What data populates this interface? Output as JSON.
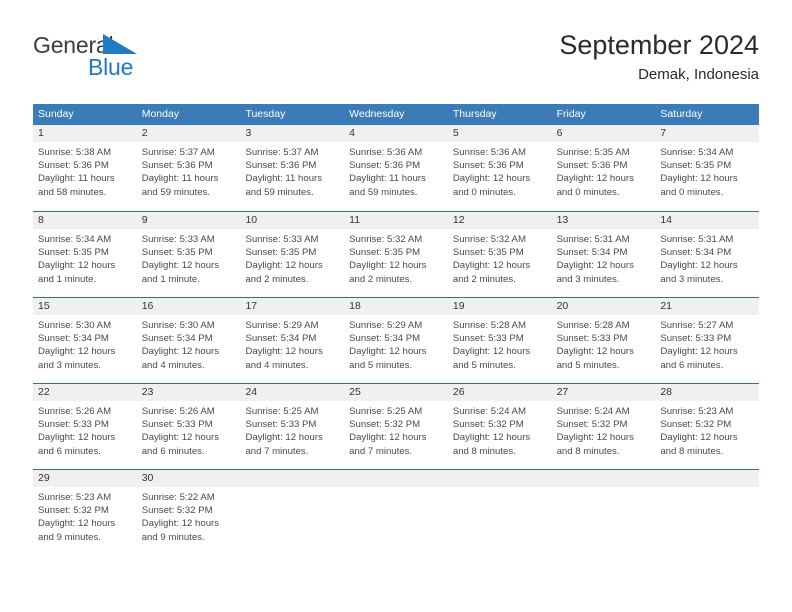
{
  "brand": {
    "name_part1": "General",
    "name_part2": "Blue",
    "accent_color": "#1f7bc4",
    "logo_icon": "triangle-flag-icon"
  },
  "header": {
    "title": "September 2024",
    "subtitle": "Demak, Indonesia"
  },
  "calendar": {
    "header_bg": "#3b7cb8",
    "weekday_headers": [
      "Sunday",
      "Monday",
      "Tuesday",
      "Wednesday",
      "Thursday",
      "Friday",
      "Saturday"
    ],
    "weeks": [
      [
        {
          "day": "1",
          "sunrise": "Sunrise: 5:38 AM",
          "sunset": "Sunset: 5:36 PM",
          "daylight": "Daylight: 11 hours and 58 minutes."
        },
        {
          "day": "2",
          "sunrise": "Sunrise: 5:37 AM",
          "sunset": "Sunset: 5:36 PM",
          "daylight": "Daylight: 11 hours and 59 minutes."
        },
        {
          "day": "3",
          "sunrise": "Sunrise: 5:37 AM",
          "sunset": "Sunset: 5:36 PM",
          "daylight": "Daylight: 11 hours and 59 minutes."
        },
        {
          "day": "4",
          "sunrise": "Sunrise: 5:36 AM",
          "sunset": "Sunset: 5:36 PM",
          "daylight": "Daylight: 11 hours and 59 minutes."
        },
        {
          "day": "5",
          "sunrise": "Sunrise: 5:36 AM",
          "sunset": "Sunset: 5:36 PM",
          "daylight": "Daylight: 12 hours and 0 minutes."
        },
        {
          "day": "6",
          "sunrise": "Sunrise: 5:35 AM",
          "sunset": "Sunset: 5:36 PM",
          "daylight": "Daylight: 12 hours and 0 minutes."
        },
        {
          "day": "7",
          "sunrise": "Sunrise: 5:34 AM",
          "sunset": "Sunset: 5:35 PM",
          "daylight": "Daylight: 12 hours and 0 minutes."
        }
      ],
      [
        {
          "day": "8",
          "sunrise": "Sunrise: 5:34 AM",
          "sunset": "Sunset: 5:35 PM",
          "daylight": "Daylight: 12 hours and 1 minute."
        },
        {
          "day": "9",
          "sunrise": "Sunrise: 5:33 AM",
          "sunset": "Sunset: 5:35 PM",
          "daylight": "Daylight: 12 hours and 1 minute."
        },
        {
          "day": "10",
          "sunrise": "Sunrise: 5:33 AM",
          "sunset": "Sunset: 5:35 PM",
          "daylight": "Daylight: 12 hours and 2 minutes."
        },
        {
          "day": "11",
          "sunrise": "Sunrise: 5:32 AM",
          "sunset": "Sunset: 5:35 PM",
          "daylight": "Daylight: 12 hours and 2 minutes."
        },
        {
          "day": "12",
          "sunrise": "Sunrise: 5:32 AM",
          "sunset": "Sunset: 5:35 PM",
          "daylight": "Daylight: 12 hours and 2 minutes."
        },
        {
          "day": "13",
          "sunrise": "Sunrise: 5:31 AM",
          "sunset": "Sunset: 5:34 PM",
          "daylight": "Daylight: 12 hours and 3 minutes."
        },
        {
          "day": "14",
          "sunrise": "Sunrise: 5:31 AM",
          "sunset": "Sunset: 5:34 PM",
          "daylight": "Daylight: 12 hours and 3 minutes."
        }
      ],
      [
        {
          "day": "15",
          "sunrise": "Sunrise: 5:30 AM",
          "sunset": "Sunset: 5:34 PM",
          "daylight": "Daylight: 12 hours and 3 minutes."
        },
        {
          "day": "16",
          "sunrise": "Sunrise: 5:30 AM",
          "sunset": "Sunset: 5:34 PM",
          "daylight": "Daylight: 12 hours and 4 minutes."
        },
        {
          "day": "17",
          "sunrise": "Sunrise: 5:29 AM",
          "sunset": "Sunset: 5:34 PM",
          "daylight": "Daylight: 12 hours and 4 minutes."
        },
        {
          "day": "18",
          "sunrise": "Sunrise: 5:29 AM",
          "sunset": "Sunset: 5:34 PM",
          "daylight": "Daylight: 12 hours and 5 minutes."
        },
        {
          "day": "19",
          "sunrise": "Sunrise: 5:28 AM",
          "sunset": "Sunset: 5:33 PM",
          "daylight": "Daylight: 12 hours and 5 minutes."
        },
        {
          "day": "20",
          "sunrise": "Sunrise: 5:28 AM",
          "sunset": "Sunset: 5:33 PM",
          "daylight": "Daylight: 12 hours and 5 minutes."
        },
        {
          "day": "21",
          "sunrise": "Sunrise: 5:27 AM",
          "sunset": "Sunset: 5:33 PM",
          "daylight": "Daylight: 12 hours and 6 minutes."
        }
      ],
      [
        {
          "day": "22",
          "sunrise": "Sunrise: 5:26 AM",
          "sunset": "Sunset: 5:33 PM",
          "daylight": "Daylight: 12 hours and 6 minutes."
        },
        {
          "day": "23",
          "sunrise": "Sunrise: 5:26 AM",
          "sunset": "Sunset: 5:33 PM",
          "daylight": "Daylight: 12 hours and 6 minutes."
        },
        {
          "day": "24",
          "sunrise": "Sunrise: 5:25 AM",
          "sunset": "Sunset: 5:33 PM",
          "daylight": "Daylight: 12 hours and 7 minutes."
        },
        {
          "day": "25",
          "sunrise": "Sunrise: 5:25 AM",
          "sunset": "Sunset: 5:32 PM",
          "daylight": "Daylight: 12 hours and 7 minutes."
        },
        {
          "day": "26",
          "sunrise": "Sunrise: 5:24 AM",
          "sunset": "Sunset: 5:32 PM",
          "daylight": "Daylight: 12 hours and 8 minutes."
        },
        {
          "day": "27",
          "sunrise": "Sunrise: 5:24 AM",
          "sunset": "Sunset: 5:32 PM",
          "daylight": "Daylight: 12 hours and 8 minutes."
        },
        {
          "day": "28",
          "sunrise": "Sunrise: 5:23 AM",
          "sunset": "Sunset: 5:32 PM",
          "daylight": "Daylight: 12 hours and 8 minutes."
        }
      ],
      [
        {
          "day": "29",
          "sunrise": "Sunrise: 5:23 AM",
          "sunset": "Sunset: 5:32 PM",
          "daylight": "Daylight: 12 hours and 9 minutes."
        },
        {
          "day": "30",
          "sunrise": "Sunrise: 5:22 AM",
          "sunset": "Sunset: 5:32 PM",
          "daylight": "Daylight: 12 hours and 9 minutes."
        },
        {
          "day": "",
          "sunrise": "",
          "sunset": "",
          "daylight": ""
        },
        {
          "day": "",
          "sunrise": "",
          "sunset": "",
          "daylight": ""
        },
        {
          "day": "",
          "sunrise": "",
          "sunset": "",
          "daylight": ""
        },
        {
          "day": "",
          "sunrise": "",
          "sunset": "",
          "daylight": ""
        },
        {
          "day": "",
          "sunrise": "",
          "sunset": "",
          "daylight": ""
        }
      ]
    ]
  }
}
